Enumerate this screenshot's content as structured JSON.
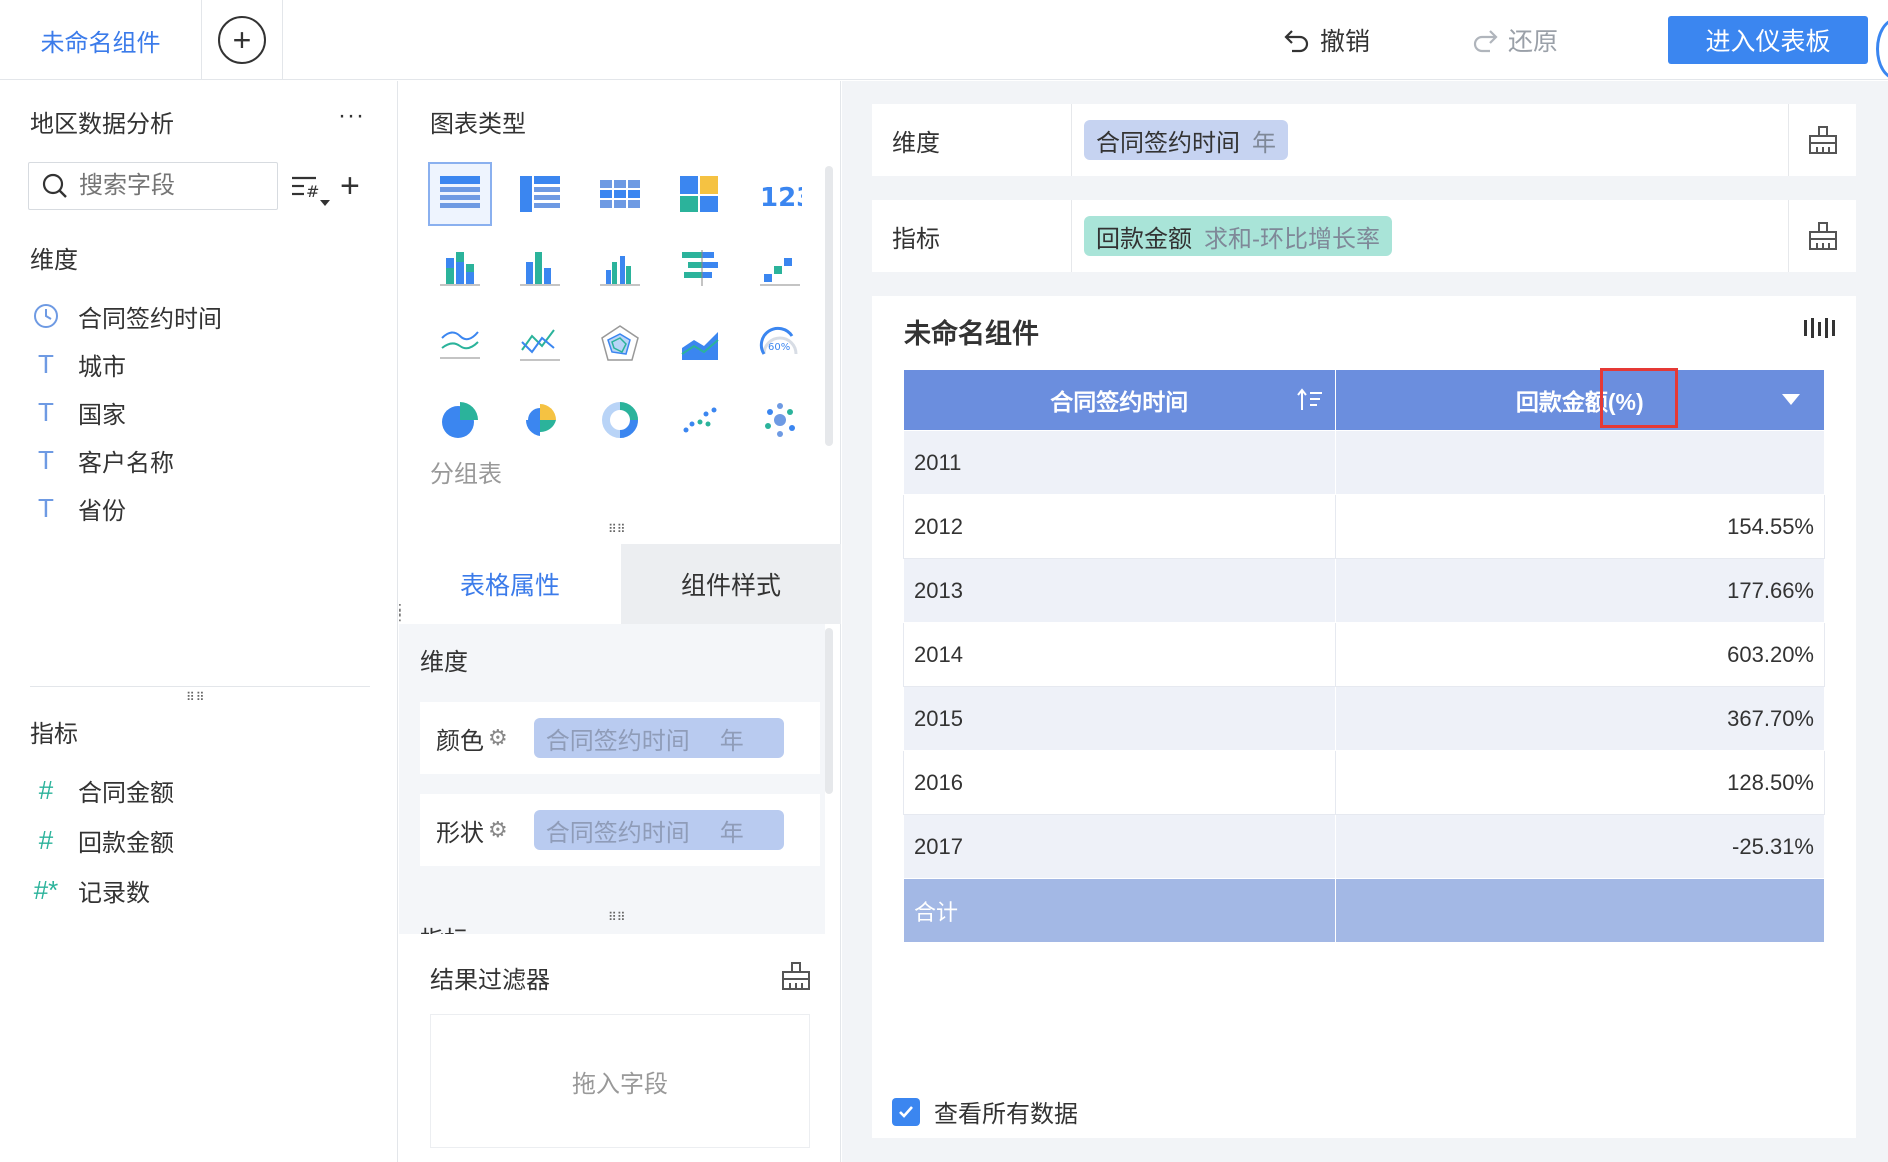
{
  "topbar": {
    "active_tab": "未命名组件",
    "undo_label": "撤销",
    "redo_label": "还原",
    "enter_dashboard_label": "进入仪表板"
  },
  "left_panel": {
    "dataset_title": "地区数据分析",
    "more_label": "···",
    "search_placeholder": "搜索字段",
    "dimension_label": "维度",
    "dimensions": [
      {
        "label": "合同签约时间",
        "icon": "clock-icon",
        "glyph": "◷"
      },
      {
        "label": "城市",
        "icon": "text-field-icon",
        "glyph": "T"
      },
      {
        "label": "国家",
        "icon": "text-field-icon",
        "glyph": "T"
      },
      {
        "label": "客户名称",
        "icon": "text-field-icon",
        "glyph": "T"
      },
      {
        "label": "省份",
        "icon": "text-field-icon",
        "glyph": "T"
      }
    ],
    "metric_label": "指标",
    "metrics": [
      {
        "label": "合同金额",
        "icon": "number-field-icon",
        "glyph": "#"
      },
      {
        "label": "回款金额",
        "icon": "number-field-icon",
        "glyph": "#"
      },
      {
        "label": "记录数",
        "icon": "count-field-icon",
        "glyph": "#*"
      }
    ]
  },
  "middle_panel": {
    "chart_type_title": "图表类型",
    "chart_type_caption": "分组表",
    "tabs": [
      {
        "label": "表格属性",
        "active": true
      },
      {
        "label": "组件样式",
        "active": false
      }
    ],
    "props_dimension_label": "维度",
    "prop_rows": [
      {
        "label": "颜色",
        "field": "合同签约时间",
        "granularity": "年"
      },
      {
        "label": "形状",
        "field": "合同签约时间",
        "granularity": "年"
      }
    ],
    "cut_label": "指标",
    "result_filter_title": "结果过滤器",
    "drop_zone_text": "拖入字段"
  },
  "right_panel": {
    "dimension_shelf": {
      "label": "维度",
      "field": "合同签约时间",
      "sub": "年",
      "color": "#c6d3f1"
    },
    "metric_shelf": {
      "label": "指标",
      "field": "回款金额",
      "sub": "求和-环比增长率",
      "color": "#a9e4d8"
    },
    "component_title": "未命名组件",
    "table": {
      "headers": [
        "合同签约时间",
        "回款金额(%)"
      ],
      "rows": [
        {
          "year": "2011",
          "value": ""
        },
        {
          "year": "2012",
          "value": "154.55%"
        },
        {
          "year": "2013",
          "value": "177.66%"
        },
        {
          "year": "2014",
          "value": "603.20%"
        },
        {
          "year": "2015",
          "value": "367.70%"
        },
        {
          "year": "2016",
          "value": "128.50%"
        },
        {
          "year": "2017",
          "value": "-25.31%"
        }
      ],
      "total_label": "合计",
      "total_value": ""
    },
    "view_all_label": "查看所有数据",
    "view_all_checked": true
  },
  "colors": {
    "accent": "#3b86f0",
    "header_blue": "#6b8ede",
    "total_blue": "#a3b8e5",
    "highlight_red": "#e53935"
  }
}
